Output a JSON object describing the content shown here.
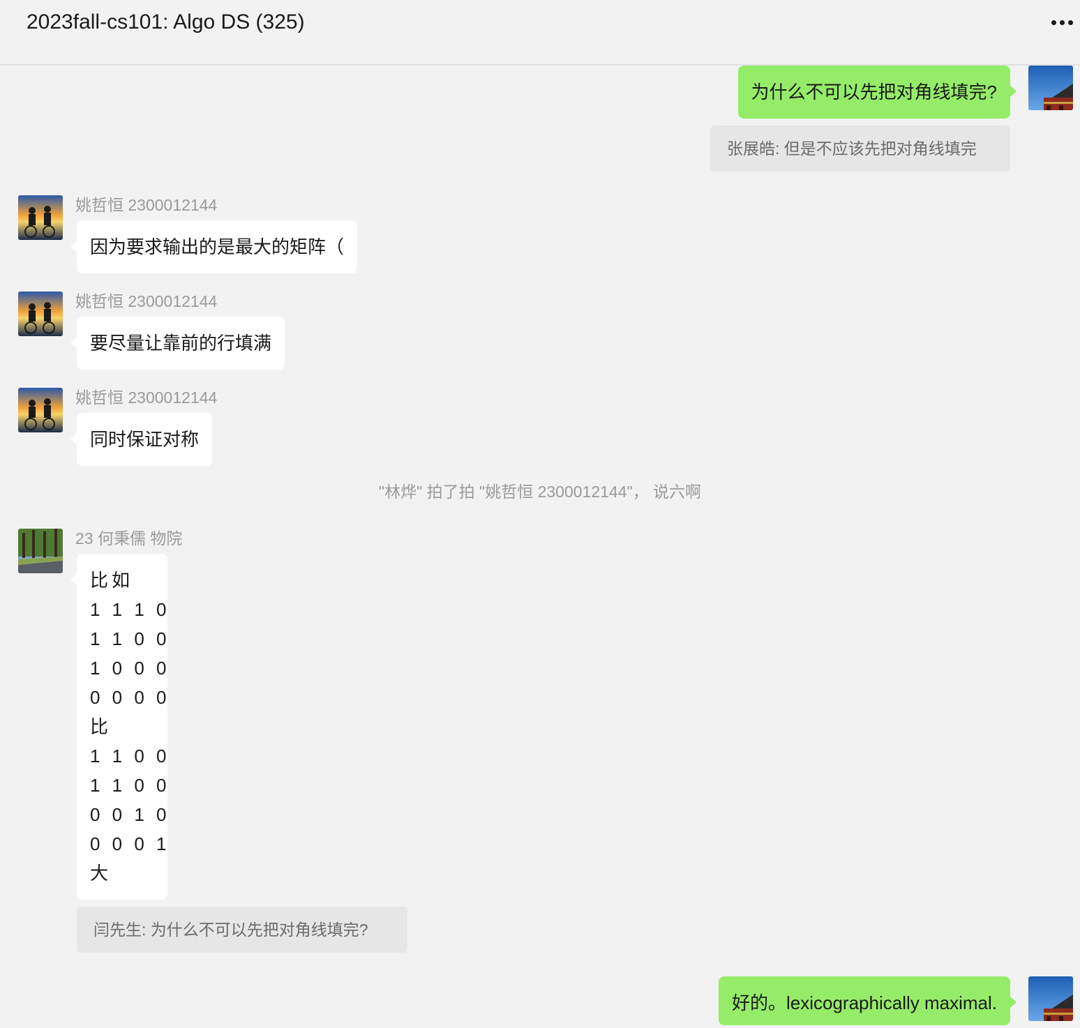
{
  "header": {
    "title": "2023fall-cs101: Algo DS  (325)",
    "more_icon": "more-dots-icon"
  },
  "messages": [
    {
      "id": "m1",
      "side": "me",
      "text": "为什么不可以先把对角线填完?",
      "quote": "张展皓: 但是不应该先把对角线填完"
    },
    {
      "id": "m2",
      "side": "other",
      "sender": "姚哲恒 2300012144",
      "text": "因为要求输出的是最大的矩阵（"
    },
    {
      "id": "m3",
      "side": "other",
      "sender": "姚哲恒 2300012144",
      "text": "要尽量让靠前的行填满"
    },
    {
      "id": "m4",
      "side": "other",
      "sender": "姚哲恒 2300012144",
      "text": "同时保证对称"
    },
    {
      "id": "sys1",
      "side": "system",
      "text": "\"林烨\" 拍了拍 \"姚哲恒 2300012144\"， 说六啊"
    },
    {
      "id": "m5",
      "side": "other",
      "sender": "23 何秉儒 物院",
      "lines": [
        "比如",
        "1 1 1 0",
        "1 1 0 0",
        "1 0 0 0",
        "0 0 0 0",
        "比",
        "1 1 0 0",
        "1 1 0 0",
        "0 0 1 0",
        "0 0 0 1",
        "大"
      ],
      "quote": "闫先生: 为什么不可以先把对角线填完?"
    },
    {
      "id": "m6",
      "side": "me",
      "text": "好的。lexicographically maximal."
    }
  ]
}
